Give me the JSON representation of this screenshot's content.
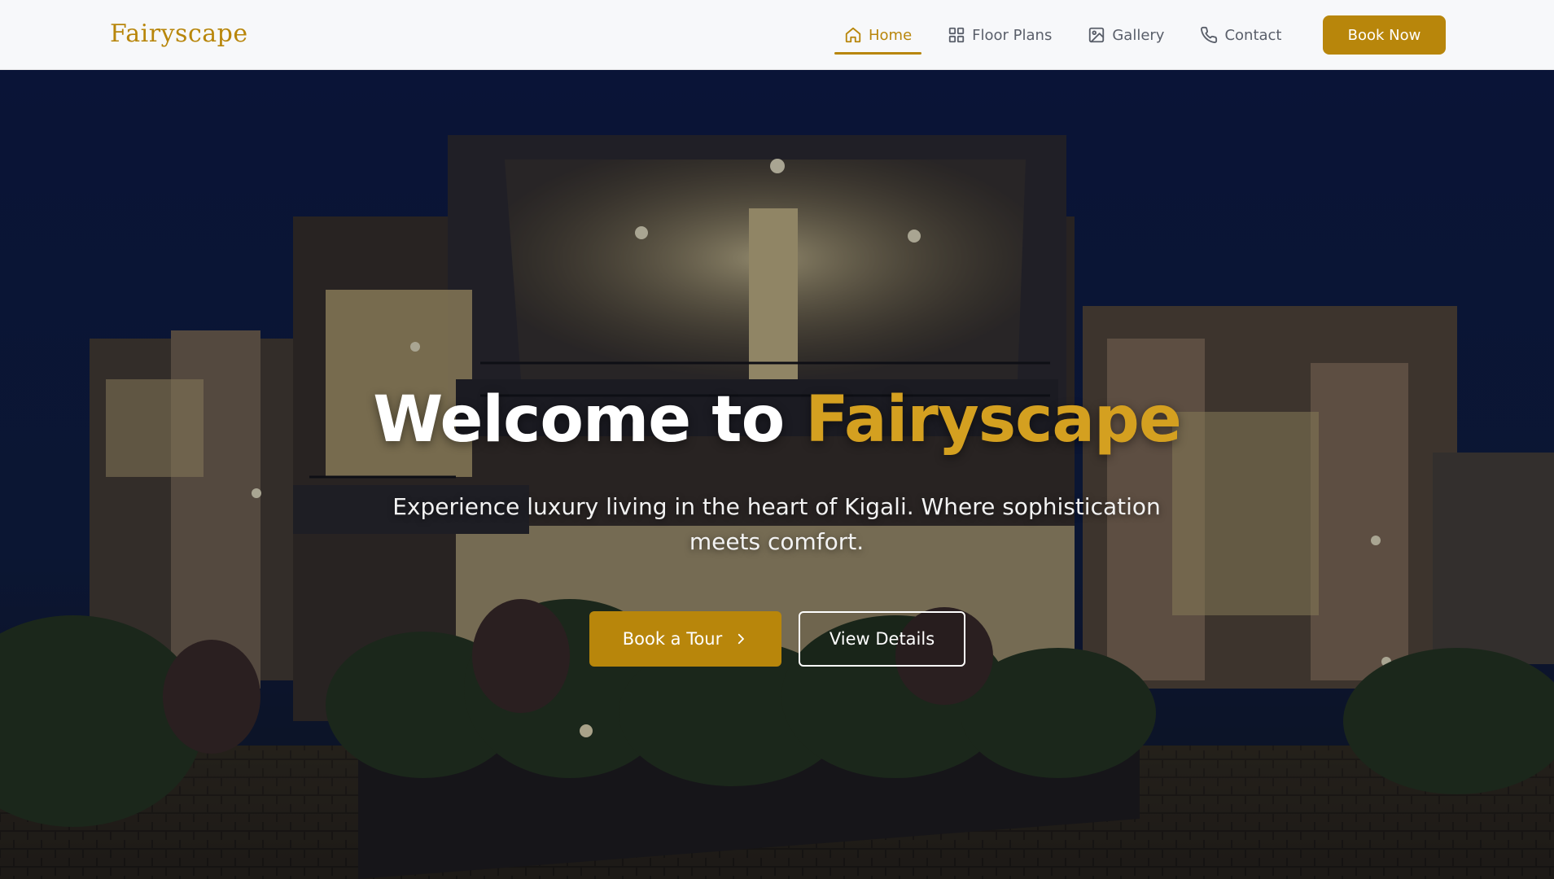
{
  "brand": {
    "name": "Fairyscape",
    "accent_color": "#b8860b"
  },
  "nav": {
    "items": [
      {
        "label": "Home",
        "icon": "home-icon",
        "active": true
      },
      {
        "label": "Floor Plans",
        "icon": "grid-icon",
        "active": false
      },
      {
        "label": "Gallery",
        "icon": "image-icon",
        "active": false
      },
      {
        "label": "Contact",
        "icon": "phone-icon",
        "active": false
      }
    ],
    "cta_label": "Book Now"
  },
  "hero": {
    "title_prefix": "Welcome to ",
    "title_accent": "Fairyscape",
    "subtitle": "Experience luxury living in the heart of Kigali. Where sophistication meets comfort.",
    "primary_button": "Book a Tour",
    "secondary_button": "View Details",
    "background": "night-photo-of-modern-luxury-villa"
  }
}
